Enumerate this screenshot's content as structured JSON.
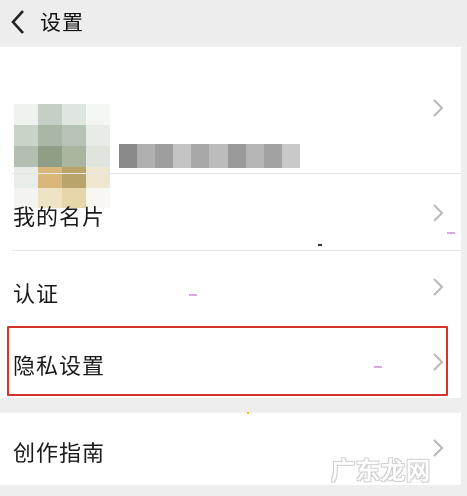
{
  "header": {
    "title": "设置",
    "back_icon": "chevron-left-icon"
  },
  "profile": {
    "avatar": "blurred-avatar",
    "nickname_blurred": true,
    "chevron_icon": "chevron-right-icon"
  },
  "menu": {
    "items": [
      {
        "label": "我的名片",
        "chevron_icon": "chevron-right-icon"
      },
      {
        "label": "认证",
        "chevron_icon": "chevron-right-icon"
      },
      {
        "label": "隐私设置",
        "chevron_icon": "chevron-right-icon",
        "highlighted": true,
        "highlight_color": "#d6332b"
      },
      {
        "label": "创作指南",
        "chevron_icon": "chevron-right-icon"
      }
    ]
  },
  "watermark": {
    "text": "广东龙网"
  },
  "colors": {
    "background": "#eeeeee",
    "card": "#ffffff",
    "chevron": "#b8b8b8",
    "highlight": "#d6332b"
  }
}
